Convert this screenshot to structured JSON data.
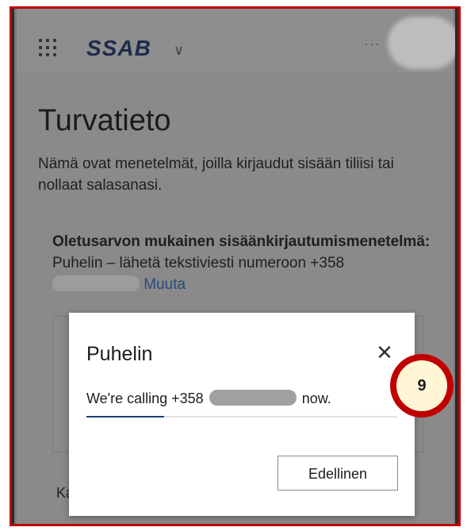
{
  "header": {
    "brand": "SSAB",
    "more_label": "···"
  },
  "page": {
    "title": "Turvatieto",
    "description": "Nämä ovat menetelmät, joilla kirjaudut sisään tiliisi tai nollaat salasanasi.",
    "default_method_label": "Oletusarvon mukainen sisäänkirjautumismenetelmä:",
    "default_method_value": "Puhelin – lähetä tekstiviesti numeroon +358",
    "change_link": "Muuta",
    "behind_text": "Ka"
  },
  "dialog": {
    "title": "Puhelin",
    "message_prefix": "We're calling +358",
    "message_suffix": "now.",
    "progress_fraction": 0.25,
    "back_button": "Edellinen"
  },
  "annotation": {
    "step_number": "9"
  },
  "colors": {
    "annotation_red": "#c00000",
    "link_blue": "#264b7a",
    "progress_blue": "#1e3f6f"
  }
}
